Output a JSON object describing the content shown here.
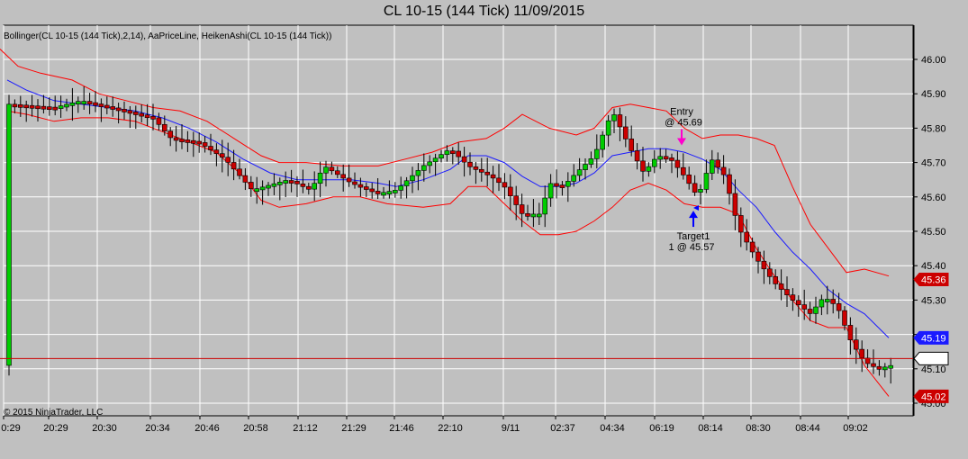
{
  "window": {
    "title": "CL 10-15 (144 Tick)  11/09/2015"
  },
  "indicators_label": "Bollinger(CL 10-15 (144 Tick),2,14), AaPriceLine, HeikenAshi(CL 10-15 (144 Tick))",
  "copyright": "© 2015 NinjaTrader, LLC",
  "colors": {
    "background": "#c0c0c0",
    "grid": "#ffffff",
    "bull": "#00cc00",
    "bear": "#cc0000",
    "band": "#ff0000",
    "mid": "#1a1aff",
    "price_line": "#cc0000",
    "entry_arrow": "#ff00cc",
    "target_arrow": "#0000ff"
  },
  "chart_data": {
    "type": "candlestick",
    "x_labels": [
      "0:29",
      "20:29",
      "20:30",
      "20:34",
      "20:46",
      "20:58",
      "21:12",
      "21:29",
      "21:46",
      "22:10",
      "9/11",
      "02:37",
      "04:34",
      "06:19",
      "08:14",
      "08:30",
      "08:44",
      "09:02"
    ],
    "y_ticks": [
      "46.00",
      "45.90",
      "45.80",
      "45.70",
      "45.60",
      "45.50",
      "45.40",
      "45.30",
      "45.20",
      "45.10",
      "45.00"
    ],
    "ylim": [
      45.0,
      46.05
    ],
    "grid": true,
    "badges": [
      {
        "label": "45.36",
        "value": 45.36,
        "color": "#cc0000"
      },
      {
        "label": "45.19",
        "value": 45.19,
        "color": "#1a1aff"
      },
      {
        "label": "45.13",
        "value": 45.13,
        "color": "#ffffff"
      },
      {
        "label": "45.02",
        "value": 45.02,
        "color": "#cc0000"
      }
    ],
    "price_line": 45.13,
    "upper_band": [
      [
        0,
        46.03
      ],
      [
        20,
        45.98
      ],
      [
        45,
        45.96
      ],
      [
        80,
        45.94
      ],
      [
        110,
        45.9
      ],
      [
        140,
        45.88
      ],
      [
        170,
        45.86
      ],
      [
        200,
        45.85
      ],
      [
        230,
        45.82
      ],
      [
        260,
        45.77
      ],
      [
        290,
        45.72
      ],
      [
        310,
        45.7
      ],
      [
        340,
        45.7
      ],
      [
        380,
        45.69
      ],
      [
        420,
        45.69
      ],
      [
        450,
        45.71
      ],
      [
        480,
        45.73
      ],
      [
        510,
        45.76
      ],
      [
        540,
        45.77
      ],
      [
        560,
        45.8
      ],
      [
        580,
        45.84
      ],
      [
        610,
        45.8
      ],
      [
        640,
        45.78
      ],
      [
        660,
        45.8
      ],
      [
        680,
        45.86
      ],
      [
        700,
        45.87
      ],
      [
        720,
        45.86
      ],
      [
        740,
        45.85
      ],
      [
        760,
        45.8
      ],
      [
        780,
        45.77
      ],
      [
        800,
        45.78
      ],
      [
        820,
        45.78
      ],
      [
        840,
        45.77
      ],
      [
        860,
        45.75
      ],
      [
        880,
        45.63
      ],
      [
        900,
        45.52
      ],
      [
        920,
        45.45
      ],
      [
        940,
        45.38
      ],
      [
        960,
        45.39
      ],
      [
        987,
        45.37
      ]
    ],
    "middle_band": [
      [
        8,
        45.94
      ],
      [
        30,
        45.91
      ],
      [
        60,
        45.88
      ],
      [
        90,
        45.87
      ],
      [
        120,
        45.86
      ],
      [
        150,
        45.85
      ],
      [
        180,
        45.83
      ],
      [
        210,
        45.8
      ],
      [
        240,
        45.76
      ],
      [
        270,
        45.71
      ],
      [
        300,
        45.67
      ],
      [
        330,
        45.65
      ],
      [
        360,
        45.65
      ],
      [
        390,
        45.65
      ],
      [
        420,
        45.64
      ],
      [
        440,
        45.63
      ],
      [
        470,
        45.65
      ],
      [
        500,
        45.68
      ],
      [
        520,
        45.72
      ],
      [
        540,
        45.72
      ],
      [
        560,
        45.7
      ],
      [
        580,
        45.66
      ],
      [
        600,
        45.63
      ],
      [
        620,
        45.63
      ],
      [
        640,
        45.64
      ],
      [
        660,
        45.67
      ],
      [
        680,
        45.72
      ],
      [
        700,
        45.73
      ],
      [
        720,
        45.74
      ],
      [
        740,
        45.74
      ],
      [
        760,
        45.73
      ],
      [
        780,
        45.71
      ],
      [
        800,
        45.68
      ],
      [
        820,
        45.62
      ],
      [
        840,
        45.57
      ],
      [
        860,
        45.5
      ],
      [
        880,
        45.44
      ],
      [
        900,
        45.39
      ],
      [
        920,
        45.33
      ],
      [
        940,
        45.29
      ],
      [
        960,
        45.26
      ],
      [
        987,
        45.19
      ]
    ],
    "lower_band": [
      [
        8,
        45.85
      ],
      [
        30,
        45.84
      ],
      [
        60,
        45.82
      ],
      [
        90,
        45.83
      ],
      [
        120,
        45.83
      ],
      [
        150,
        45.82
      ],
      [
        180,
        45.79
      ],
      [
        210,
        45.76
      ],
      [
        240,
        45.73
      ],
      [
        270,
        45.66
      ],
      [
        290,
        45.59
      ],
      [
        310,
        45.57
      ],
      [
        340,
        45.58
      ],
      [
        370,
        45.6
      ],
      [
        400,
        45.6
      ],
      [
        430,
        45.58
      ],
      [
        470,
        45.57
      ],
      [
        500,
        45.58
      ],
      [
        520,
        45.63
      ],
      [
        540,
        45.63
      ],
      [
        560,
        45.58
      ],
      [
        580,
        45.53
      ],
      [
        600,
        45.49
      ],
      [
        620,
        45.49
      ],
      [
        640,
        45.5
      ],
      [
        660,
        45.53
      ],
      [
        680,
        45.57
      ],
      [
        700,
        45.62
      ],
      [
        720,
        45.64
      ],
      [
        740,
        45.62
      ],
      [
        760,
        45.58
      ],
      [
        780,
        45.57
      ],
      [
        800,
        45.57
      ],
      [
        820,
        45.55
      ],
      [
        840,
        45.45
      ],
      [
        860,
        45.37
      ],
      [
        880,
        45.3
      ],
      [
        900,
        45.24
      ],
      [
        920,
        45.22
      ],
      [
        940,
        45.22
      ],
      [
        960,
        45.11
      ],
      [
        987,
        45.02
      ]
    ],
    "candle_pivots": [
      [
        8,
        45.87
      ],
      [
        60,
        45.86
      ],
      [
        90,
        45.88
      ],
      [
        140,
        45.85
      ],
      [
        170,
        45.83
      ],
      [
        190,
        45.77
      ],
      [
        220,
        45.76
      ],
      [
        250,
        45.71
      ],
      [
        280,
        45.62
      ],
      [
        320,
        45.65
      ],
      [
        345,
        45.62
      ],
      [
        360,
        45.69
      ],
      [
        390,
        45.64
      ],
      [
        420,
        45.61
      ],
      [
        440,
        45.62
      ],
      [
        470,
        45.69
      ],
      [
        500,
        45.74
      ],
      [
        520,
        45.69
      ],
      [
        545,
        45.66
      ],
      [
        560,
        45.63
      ],
      [
        580,
        45.55
      ],
      [
        600,
        45.55
      ],
      [
        610,
        45.64
      ],
      [
        625,
        45.63
      ],
      [
        640,
        45.67
      ],
      [
        660,
        45.72
      ],
      [
        680,
        45.85
      ],
      [
        700,
        45.74
      ],
      [
        715,
        45.67
      ],
      [
        730,
        45.72
      ],
      [
        745,
        45.71
      ],
      [
        760,
        45.66
      ],
      [
        775,
        45.6
      ],
      [
        790,
        45.71
      ],
      [
        805,
        45.66
      ],
      [
        820,
        45.51
      ],
      [
        840,
        45.42
      ],
      [
        860,
        45.35
      ],
      [
        880,
        45.3
      ],
      [
        900,
        45.26
      ],
      [
        915,
        45.31
      ],
      [
        930,
        45.28
      ],
      [
        945,
        45.18
      ],
      [
        960,
        45.12
      ],
      [
        975,
        45.1
      ],
      [
        990,
        45.11
      ]
    ],
    "annotations": [
      {
        "lines": [
          "Entry",
          "@ 45.69"
        ],
        "x": 757,
        "value": 45.75,
        "arrow": "down",
        "arrow_color": "#ff00cc"
      },
      {
        "lines": [
          "Target1",
          "1 @ 45.57"
        ],
        "x": 770,
        "value": 45.56,
        "arrow": "up",
        "arrow_color": "#0000ff"
      }
    ]
  }
}
